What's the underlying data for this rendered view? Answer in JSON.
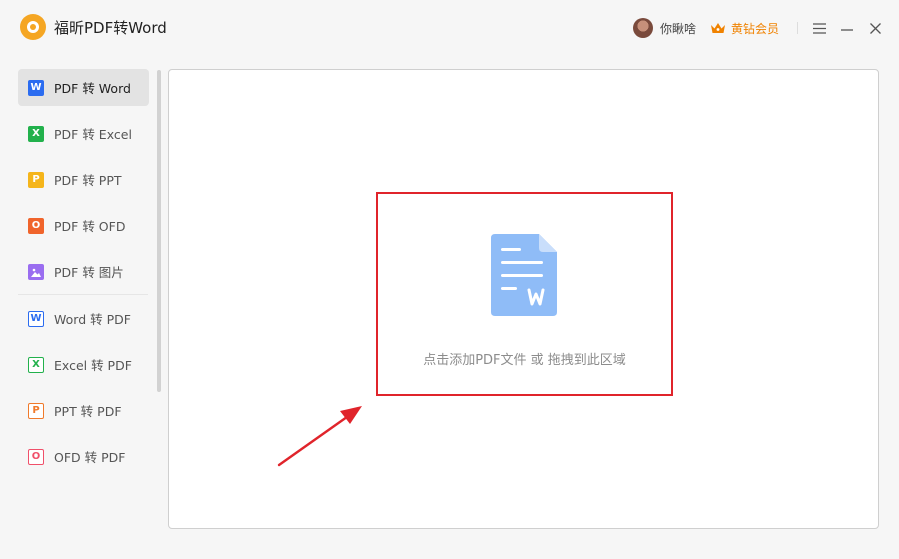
{
  "app": {
    "title": "福昕PDF转Word"
  },
  "header": {
    "user_name": "你瞅啥",
    "vip_label": "黄钻会员",
    "vip_color": "#f08200"
  },
  "sidebar": {
    "items": [
      {
        "label": "PDF 转 Word",
        "icon": "word-icon",
        "color": "#2b6cf0",
        "glyph": "W",
        "active": true
      },
      {
        "label": "PDF 转 Excel",
        "icon": "excel-icon",
        "color": "#22b14c",
        "glyph": "X"
      },
      {
        "label": "PDF 转 PPT",
        "icon": "ppt-icon",
        "color": "#f5b51b",
        "glyph": "P"
      },
      {
        "label": "PDF 转 OFD",
        "icon": "ofd-icon",
        "color": "#f0642b",
        "glyph": "O"
      },
      {
        "label": "PDF 转 图片",
        "icon": "image-icon",
        "color": "#9a6df0",
        "glyph": ""
      },
      {
        "label": "Word 转 PDF",
        "icon": "word-doc-icon",
        "color": "#2b6cf0",
        "glyph": "W"
      },
      {
        "label": "Excel 转 PDF",
        "icon": "excel-doc-icon",
        "color": "#22b14c",
        "glyph": "X"
      },
      {
        "label": "PPT 转 PDF",
        "icon": "ppt-doc-icon",
        "color": "#f07a2b",
        "glyph": "P"
      },
      {
        "label": "OFD 转 PDF",
        "icon": "ofd-doc-icon",
        "color": "#f0506a",
        "glyph": "O"
      }
    ]
  },
  "main": {
    "drop_text": "点击添加PDF文件 或 拖拽到此区域",
    "highlight_color": "#e0242b"
  }
}
